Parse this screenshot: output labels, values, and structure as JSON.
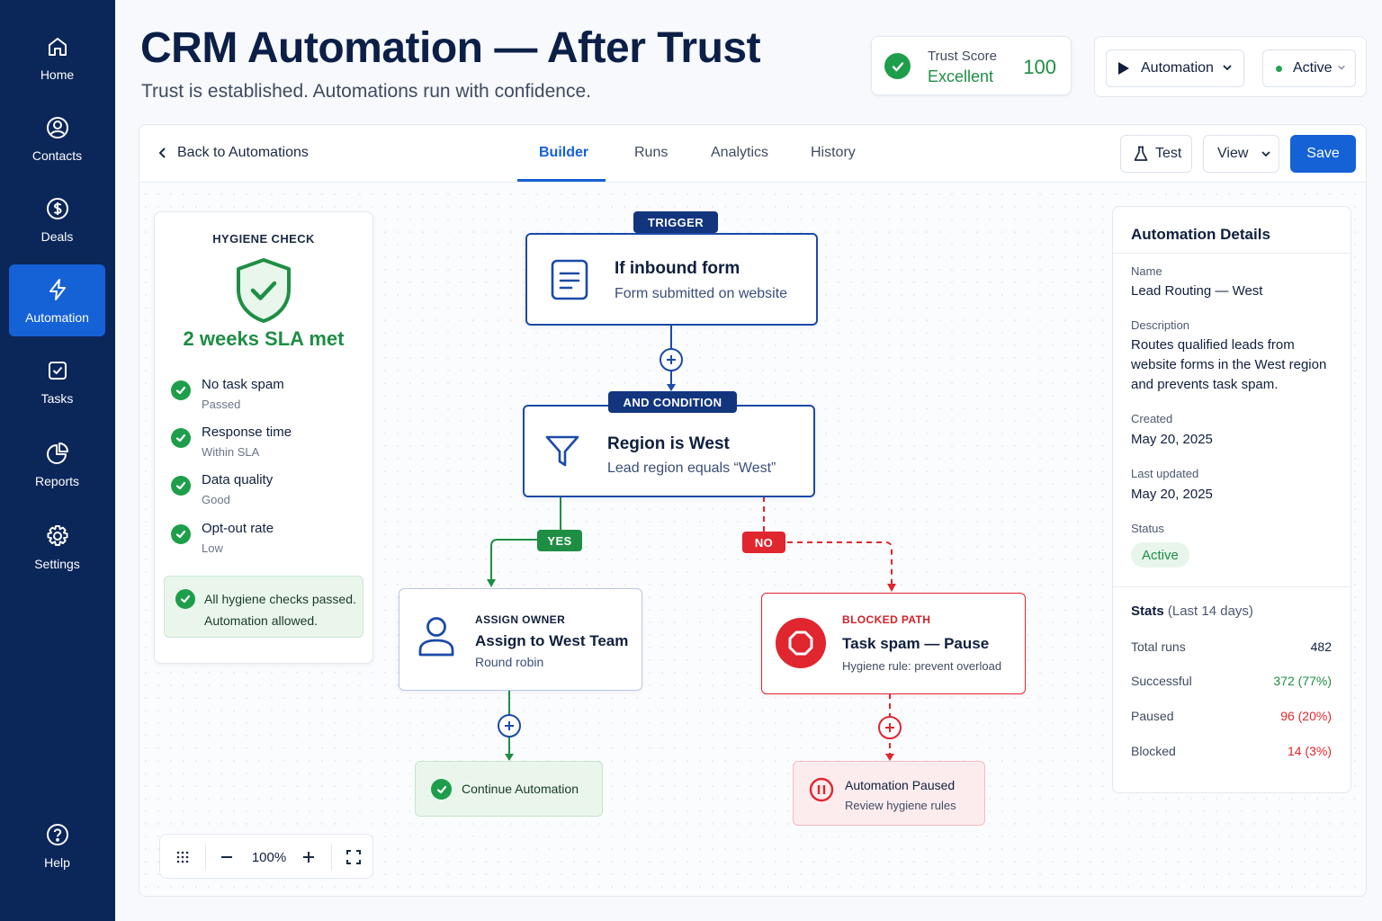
{
  "sidebar": {
    "items": [
      {
        "label": "Home",
        "icon": "home-icon"
      },
      {
        "label": "Contacts",
        "icon": "user-circle-icon"
      },
      {
        "label": "Deals",
        "icon": "dollar-icon"
      },
      {
        "label": "Automation",
        "icon": "lightning-icon",
        "active": true
      },
      {
        "label": "Tasks",
        "icon": "checkbox-icon"
      },
      {
        "label": "Reports",
        "icon": "pie-chart-icon"
      },
      {
        "label": "Settings",
        "icon": "gear-icon"
      }
    ],
    "help_label": "Help"
  },
  "header": {
    "title": "CRM Automation — After Trust",
    "subtitle": "Trust is established. Automations run with confidence."
  },
  "trust": {
    "label": "Trust Score",
    "rating": "Excellent",
    "score": "100"
  },
  "controls": {
    "automation_label": "Automation",
    "status_label": "Active"
  },
  "toolbar": {
    "back_label": "Back to Automations",
    "tabs": [
      {
        "label": "Builder",
        "active": true
      },
      {
        "label": "Runs"
      },
      {
        "label": "Analytics"
      },
      {
        "label": "History"
      }
    ],
    "test_label": "Test",
    "view_label": "View",
    "save_label": "Save"
  },
  "hygiene": {
    "title": "HYGIENE CHECK",
    "sla": "2 weeks SLA met",
    "checks": [
      {
        "label": "No task spam",
        "status": "Passed"
      },
      {
        "label": "Response time",
        "status": "Within SLA"
      },
      {
        "label": "Data quality",
        "status": "Good"
      },
      {
        "label": "Opt-out rate",
        "status": "Low"
      }
    ],
    "result_line1": "All hygiene checks passed.",
    "result_line2": "Automation allowed."
  },
  "flow": {
    "trigger": {
      "pill": "TRIGGER",
      "title": "If inbound form",
      "subtitle": "Form submitted on website"
    },
    "condition": {
      "pill": "AND CONDITION",
      "title": "Region is West",
      "subtitle": "Lead region equals “West”"
    },
    "yes_label": "YES",
    "no_label": "NO",
    "assign": {
      "kicker": "ASSIGN OWNER",
      "title": "Assign to West Team",
      "subtitle": "Round robin"
    },
    "blocked": {
      "kicker": "BLOCKED PATH",
      "title": "Task spam — Pause",
      "subtitle": "Hygiene rule: prevent overload"
    },
    "continue_label": "Continue Automation",
    "paused": {
      "title": "Automation Paused",
      "subtitle": "Review hygiene rules"
    }
  },
  "zoom": {
    "level": "100%"
  },
  "details": {
    "title": "Automation Details",
    "name_label": "Name",
    "name": "Lead Routing — West",
    "description_label": "Description",
    "description": "Routes qualified leads from website forms in the West region and prevents task spam.",
    "created_label": "Created",
    "created": "May 20, 2025",
    "updated_label": "Last updated",
    "updated": "May 20, 2025",
    "status_label": "Status",
    "status": "Active",
    "stats_title": "Stats",
    "stats_period": "(Last 14 days)",
    "stats": [
      {
        "label": "Total runs",
        "value": "482"
      },
      {
        "label": "Successful",
        "value": "372 (77%)"
      },
      {
        "label": "Paused",
        "value": "96 (20%)"
      },
      {
        "label": "Blocked",
        "value": "14 (3%)"
      }
    ]
  },
  "colors": {
    "sidebar": "#0b2659",
    "accent": "#1561d6",
    "success": "#1e8e44",
    "danger": "#e0262f",
    "flow_blue": "#1b4aa8"
  }
}
